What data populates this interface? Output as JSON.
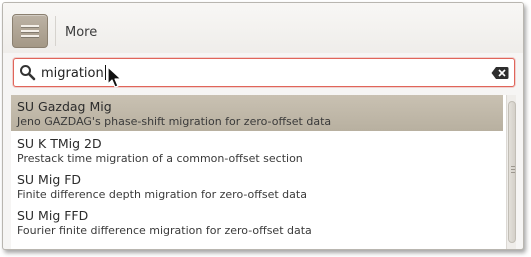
{
  "header": {
    "title": "More",
    "menu_icon": "hamburger-menu-icon"
  },
  "search": {
    "value": "migration",
    "icon": "magnifier-icon",
    "clear_icon": "clear-backspace-icon"
  },
  "results": [
    {
      "name": "SU Gazdag Mig",
      "description": "Jeno GAZDAG's phase-shift migration for zero-offset data",
      "selected": true
    },
    {
      "name": "SU K TMig 2D",
      "description": "Prestack time migration of a common-offset section",
      "selected": false
    },
    {
      "name": "SU Mig FD",
      "description": "Finite difference depth migration for zero-offset data",
      "selected": false
    },
    {
      "name": "SU Mig FFD",
      "description": "Fourier finite difference migration for zero-offset data",
      "selected": false
    }
  ],
  "colors": {
    "selected_row": "#bdb4a4",
    "search_focus_border": "#e0655a",
    "menu_button": "#a89c8a"
  }
}
